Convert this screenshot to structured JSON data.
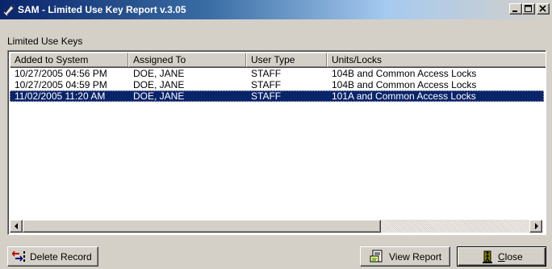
{
  "window": {
    "title": "SAM - Limited Use Key Report v.3.05",
    "minimize_symbol": "_",
    "maximize_symbol": "□",
    "close_symbol": "×"
  },
  "colors": {
    "titlebar_start": "#0a246a",
    "titlebar_end": "#d4d0c8",
    "selection": "#0a246a",
    "face": "#d4d0c8"
  },
  "list": {
    "label": "Limited Use Keys",
    "columns": [
      "Added to System",
      "Assigned To",
      "User Type",
      "Units/Locks"
    ],
    "rows": [
      {
        "added": "10/27/2005 04:56 PM",
        "assigned": "DOE, JANE",
        "type": "STAFF",
        "units": "104B and Common Access Locks"
      },
      {
        "added": "10/27/2005 04:59 PM",
        "assigned": "DOE, JANE",
        "type": "STAFF",
        "units": "104B and Common Access Locks"
      },
      {
        "added": "11/02/2005 11:20 AM",
        "assigned": "DOE, JANE",
        "type": "STAFF",
        "units": "101A and Common Access Locks"
      }
    ],
    "selected_row": 3
  },
  "buttons": {
    "delete": {
      "label": "Delete Record",
      "icon": "delete-record-icon"
    },
    "view": {
      "label": "View Report",
      "icon": "view-report-icon"
    },
    "close": {
      "label": "Close",
      "icon": "exit-door-icon"
    }
  }
}
